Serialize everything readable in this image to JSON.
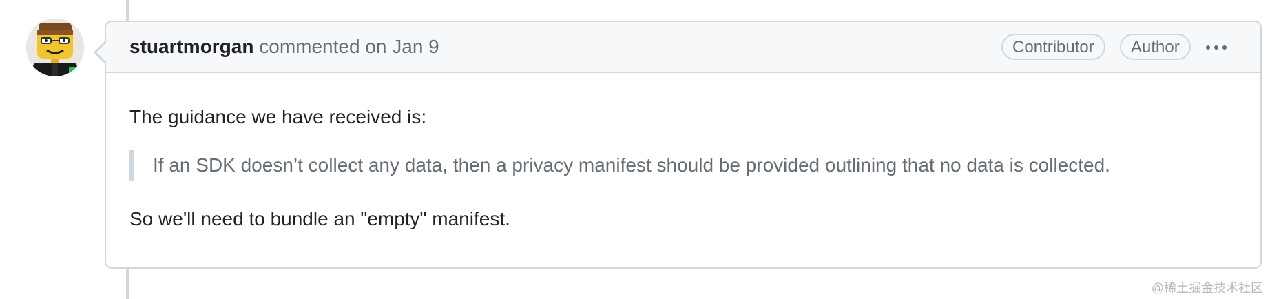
{
  "comment": {
    "author": "stuartmorgan",
    "action": "commented on",
    "date": "Jan 9",
    "badges": [
      "Contributor",
      "Author"
    ],
    "more_icon": "kebab-horizontal-icon",
    "body": {
      "paragraph1": "The guidance we have received is:",
      "blockquote": "If an SDK doesn’t collect any data, then a privacy manifest should be provided outlining that no data is collected.",
      "paragraph2": "So we'll need to bundle an \"empty\" manifest."
    }
  },
  "watermark": "@稀土掘金技术社区",
  "colors": {
    "border": "#d0d7de",
    "header_bg": "#f6f8fa",
    "muted_text": "#656d76",
    "text": "#1f2328"
  }
}
